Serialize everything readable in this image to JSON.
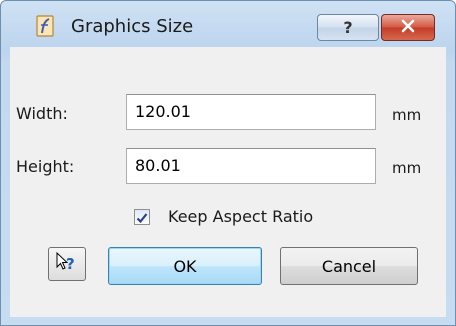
{
  "window": {
    "title": "Graphics Size",
    "help_button_glyph": "?",
    "icons": {
      "app": "graphics-document-icon",
      "close": "close-icon",
      "whats_this": "whats-this-pointer-icon"
    }
  },
  "form": {
    "width_label": "Width:",
    "width_value": "120.01",
    "width_unit": "mm",
    "height_label": "Height:",
    "height_value": "80.01",
    "height_unit": "mm",
    "keep_aspect_label": "Keep Aspect Ratio",
    "keep_aspect_checked": true
  },
  "buttons": {
    "ok_label": "OK",
    "cancel_label": "Cancel"
  },
  "colors": {
    "close_button": "#c53c27",
    "default_button_border": "#3c7fb1",
    "checkmark": "#2a3f8f"
  }
}
